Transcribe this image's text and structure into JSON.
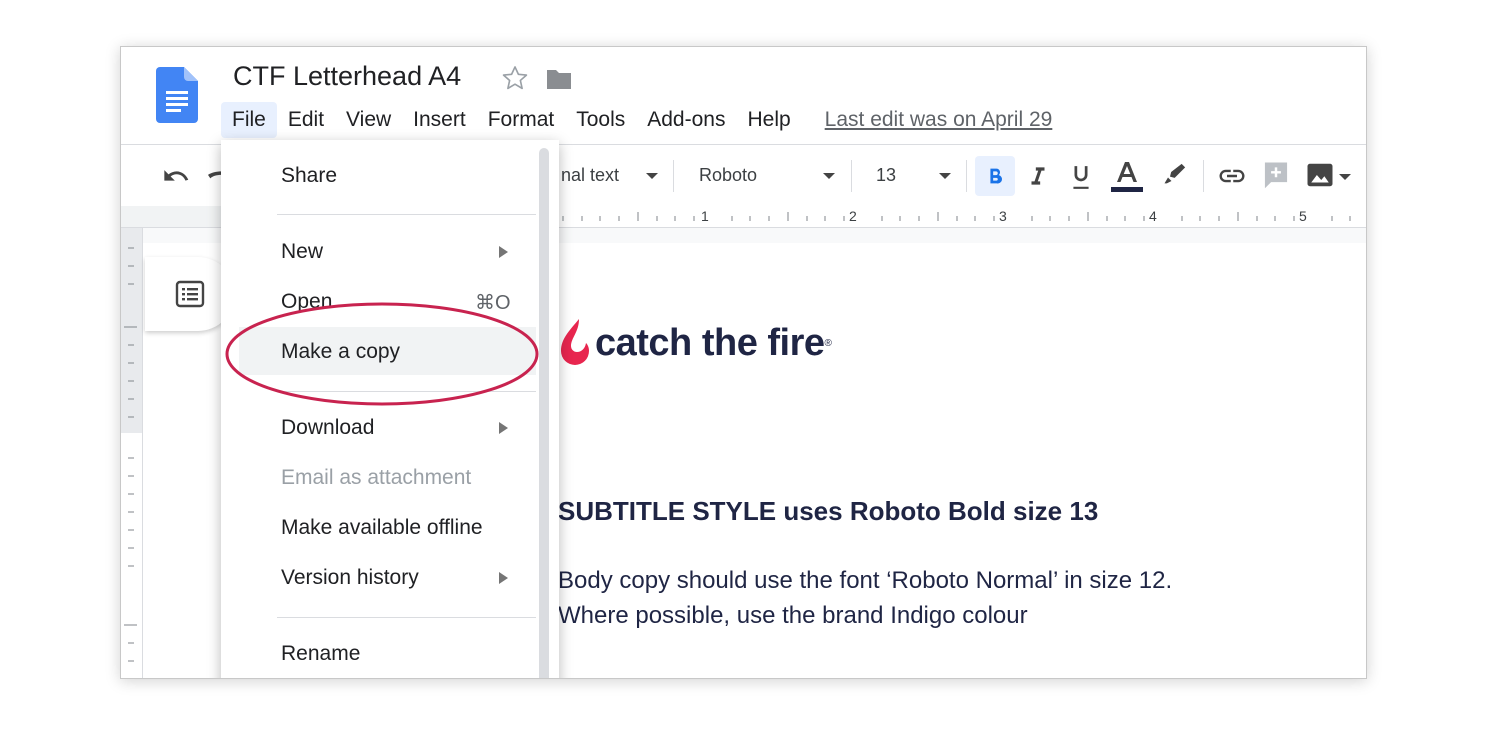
{
  "doc": {
    "title": "CTF Letterhead A4",
    "last_edit": "Last edit was on April 29"
  },
  "menubar": {
    "items": [
      "File",
      "Edit",
      "View",
      "Insert",
      "Format",
      "Tools",
      "Add-ons",
      "Help"
    ]
  },
  "toolbar": {
    "style_value": "nal text",
    "font_value": "Roboto",
    "size_value": "13",
    "text_color": "#1f2544"
  },
  "ruler": {
    "numbers": [
      "1",
      "2",
      "3",
      "4",
      "5"
    ]
  },
  "file_menu": {
    "items": [
      {
        "label": "Share"
      },
      {
        "label": "New"
      },
      {
        "label": "Open",
        "shortcut": "⌘O"
      },
      {
        "label": "Make a copy"
      },
      {
        "label": "Download"
      },
      {
        "label": "Email as attachment"
      },
      {
        "label": "Make available offline"
      },
      {
        "label": "Version history"
      },
      {
        "label": "Rename"
      }
    ]
  },
  "document": {
    "brand_name": "catch the fire",
    "brand_reg": "®",
    "subtitle": "SUBTITLE STYLE uses Roboto Bold size 13",
    "body_line_1": "Body copy should use the font ‘Roboto Normal’ in size 12.",
    "body_line_2": "Where possible, use the brand Indigo colour"
  },
  "colors": {
    "brand_indigo": "#1f2544",
    "brand_red": "#e8264f",
    "annotation": "#c8234f",
    "docs_blue": "#4285f4"
  },
  "icons": [
    "docs-logo-icon",
    "star-icon",
    "folder-icon",
    "undo-icon",
    "redo-icon",
    "bold-icon",
    "italic-icon",
    "underline-icon",
    "text-color-icon",
    "highlighter-icon",
    "link-icon",
    "add-comment-icon",
    "insert-image-icon",
    "outline-icon",
    "submenu-arrow-icon"
  ]
}
